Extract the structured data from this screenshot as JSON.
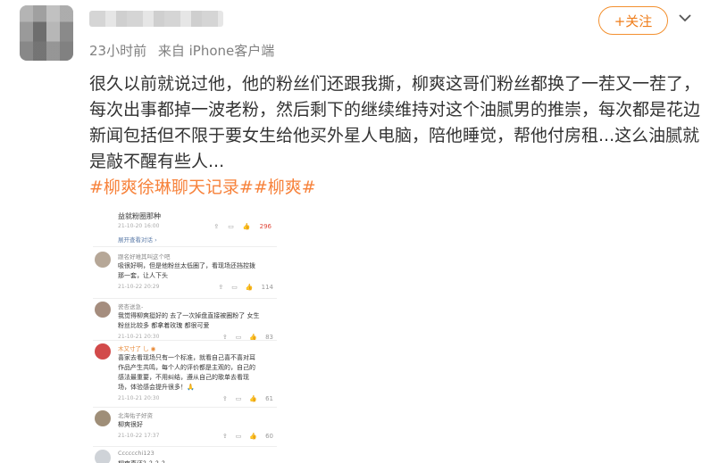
{
  "post": {
    "meta_time": "23小时前",
    "meta_source": "来自 iPhone客户端",
    "follow_label": "+关注",
    "text_lines": [
      "很久以前就说过他，他的粉丝们还跟我撕，柳爽这哥们粉丝都换了一茬又一茬了，",
      "每次出事都掉一波老粉，然后剩下的继续维持对这个油腻男的推崇，每次都是花边",
      "新闻包括但不限于要女生给他买外星人电脑，陪他睡觉，帮他付房租...这么油腻就",
      "是敲不醒有些人..."
    ],
    "tags": "#柳爽徐琳聊天记录##柳爽#"
  },
  "embed": {
    "title": "益就粉圈那种",
    "subtitle": "21-10-20 16:00",
    "open_text": "展开查看对话 ›",
    "top_likes": "296",
    "comments": [
      {
        "name": "跟名好难其叫这个吧",
        "lines": [
          "吸很好啊，但是他粉丝太低圈了，看现场还挡控拨",
          "那一套，让人下头"
        ],
        "time": "21-10-22 20:29",
        "likes": "114",
        "avatar_color": "#b6a797"
      },
      {
        "name": "瓷杏送急-",
        "lines": [
          "我觉得柳爽挺好的 去了一次掉盘直接被圈粉了 女生",
          "粉丝比较多 都拿着玫瑰 都很可爱"
        ],
        "time": "21-10-21 20:30",
        "likes": "83",
        "avatar_color": "#a58d7e"
      },
      {
        "name": "木又寸了 乚 ◉",
        "lines": [
          "喜家去看现场只有一个标准，就看自己喜不喜对耳",
          "作品产生共鸣，每个人的评价都是主观的，自己的",
          "感法最重要，不用纠结，遵从自己的歌单去看现",
          "场，体验感会提升很多！🙏"
        ],
        "time": "21-10-21 20:30",
        "likes": "61",
        "avatar_color": "#d24a4a",
        "orange": true
      },
      {
        "name": "北海佑子好资",
        "lines": [
          "柳爽很好"
        ],
        "time": "21-10-22 17:37",
        "likes": "60",
        "avatar_color": "#9f8e78"
      },
      {
        "name": "Cccccchi123",
        "lines": [
          "柳爽真还？？？？"
        ],
        "time": "",
        "likes": "",
        "avatar_color": "#cfd3d8"
      }
    ]
  },
  "icons": {
    "chevron": "chevron-down-icon",
    "share": "share-icon",
    "comment": "comment-icon",
    "like": "thumbs-up-icon"
  },
  "colors": {
    "accent": "#f3902f",
    "tag": "#f7823b",
    "meta": "#808080"
  }
}
